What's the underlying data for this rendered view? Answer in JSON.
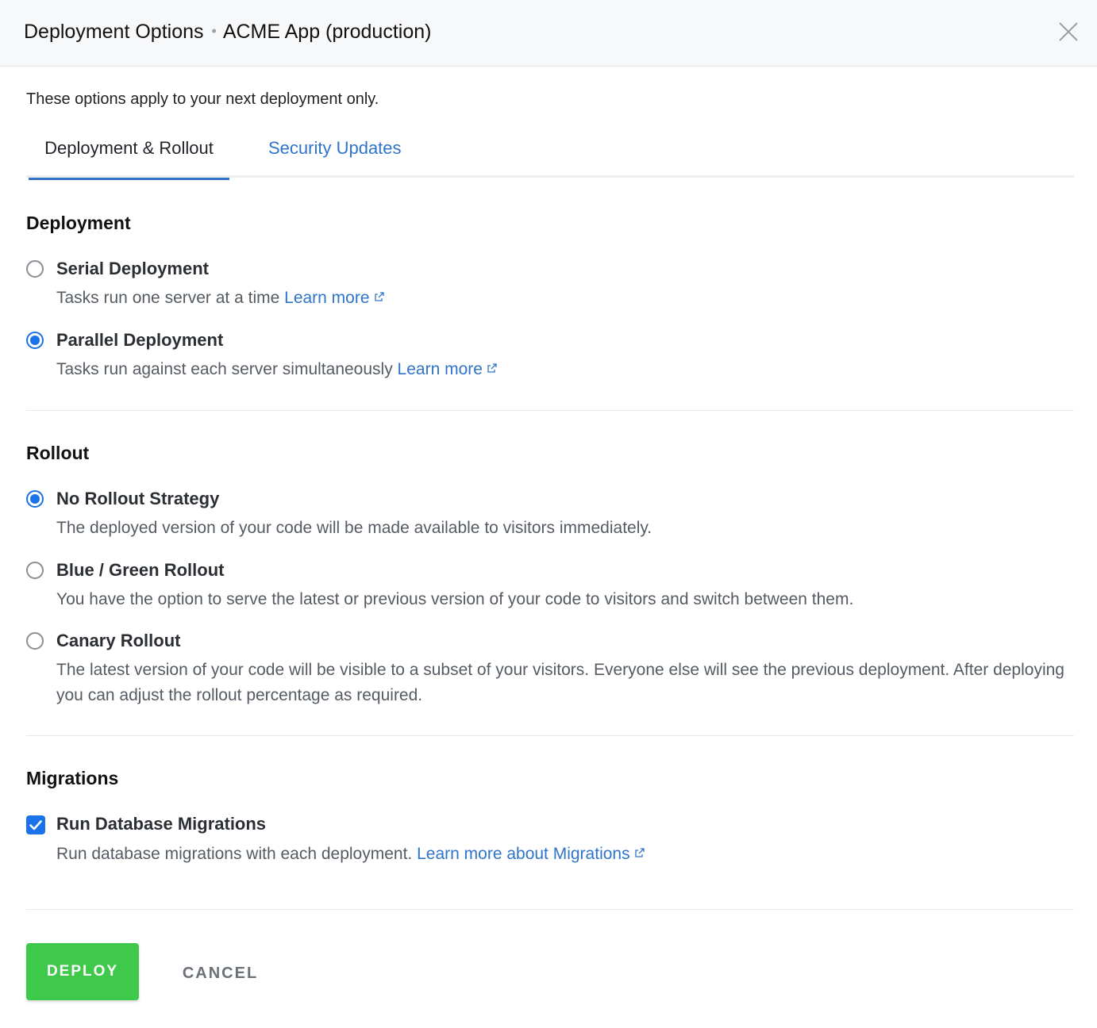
{
  "header": {
    "title": "Deployment Options",
    "separator": "•",
    "subtitle": "ACME App (production)"
  },
  "intro": "These options apply to your next deployment only.",
  "tabs": [
    {
      "label": "Deployment & Rollout",
      "active": true
    },
    {
      "label": "Security Updates",
      "active": false
    }
  ],
  "deployment": {
    "title": "Deployment",
    "options": [
      {
        "label": "Serial Deployment",
        "desc": "Tasks run one server at a time",
        "link": "Learn more",
        "checked": false
      },
      {
        "label": "Parallel Deployment",
        "desc": "Tasks run against each server simultaneously",
        "link": "Learn more",
        "checked": true
      }
    ]
  },
  "rollout": {
    "title": "Rollout",
    "options": [
      {
        "label": "No Rollout Strategy",
        "desc": "The deployed version of your code will be made available to visitors immediately.",
        "checked": true
      },
      {
        "label": "Blue / Green Rollout",
        "desc": "You have the option to serve the latest or previous version of your code to visitors and switch between them.",
        "checked": false
      },
      {
        "label": "Canary Rollout",
        "desc": "The latest version of your code will be visible to a subset of your visitors. Everyone else will see the previous deployment. After deploying you can adjust the rollout percentage as required.",
        "checked": false
      }
    ]
  },
  "migrations": {
    "title": "Migrations",
    "option": {
      "label": "Run Database Migrations",
      "desc": "Run database migrations with each deployment.",
      "link": "Learn more about Migrations",
      "checked": true
    }
  },
  "actions": {
    "deploy": "DEPLOY",
    "cancel": "CANCEL"
  },
  "colors": {
    "accent": "#1a73e8",
    "link": "#2f74c9",
    "deploy": "#3ec94b"
  },
  "icons": {
    "close": "close-icon",
    "external": "external-link-icon",
    "check": "checkmark-icon"
  }
}
